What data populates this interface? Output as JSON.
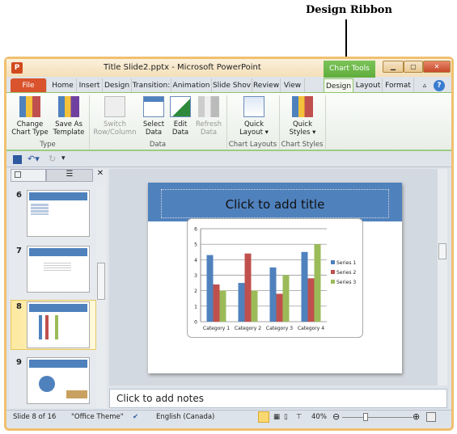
{
  "annotation": {
    "label": "Design Ribbon"
  },
  "window": {
    "title": "Title Slide2.pptx - Microsoft PowerPoint",
    "app_icon": "P",
    "context_tab": "Chart Tools"
  },
  "tabs": [
    "File",
    "Home",
    "Insert",
    "Design",
    "Transition:",
    "Animation",
    "Slide Shov",
    "Review",
    "View",
    "Design",
    "Layout",
    "Format"
  ],
  "ribbon": {
    "buttons": [
      {
        "label1": "Change",
        "label2": "Chart Type",
        "icon": "bar-chart-icon",
        "enabled": true
      },
      {
        "label1": "Save As",
        "label2": "Template",
        "icon": "save-template-icon",
        "enabled": true
      },
      {
        "label1": "Switch",
        "label2": "Row/Column",
        "icon": "switch-row-column-icon",
        "enabled": false
      },
      {
        "label1": "Select",
        "label2": "Data",
        "icon": "select-data-icon",
        "enabled": true
      },
      {
        "label1": "Edit",
        "label2": "Data",
        "icon": "excel-icon",
        "enabled": true
      },
      {
        "label1": "Refresh",
        "label2": "Data",
        "icon": "refresh-icon",
        "enabled": false
      },
      {
        "label1": "Quick",
        "label2": "Layout ▾",
        "icon": "quick-layout-icon",
        "enabled": true
      },
      {
        "label1": "Quick",
        "label2": "Styles ▾",
        "icon": "quick-styles-icon",
        "enabled": true
      }
    ],
    "groups": [
      "Type",
      "Data",
      "Chart Layouts",
      "Chart Styles"
    ]
  },
  "slides": {
    "numbers": [
      "6",
      "7",
      "8",
      "9"
    ],
    "selected": "8"
  },
  "slide": {
    "title_placeholder": "Click to add title"
  },
  "notes": {
    "placeholder": "Click to add notes"
  },
  "status": {
    "slide": "Slide 8 of 16",
    "theme": "\"Office Theme\"",
    "language": "English (Canada)",
    "zoom": "40%",
    "zoom_level": 40
  },
  "colors": {
    "series1": "#4f81bd",
    "series2": "#c0504d",
    "series3": "#9bbb59",
    "accent": "#d9532c",
    "chart_tools": "#6cb84a"
  },
  "chart_data": {
    "type": "bar",
    "categories": [
      "Category 1",
      "Category 2",
      "Category 3",
      "Category 4"
    ],
    "series": [
      {
        "name": "Series 1",
        "values": [
          4.3,
          2.5,
          3.5,
          4.5
        ]
      },
      {
        "name": "Series 2",
        "values": [
          2.4,
          4.4,
          1.8,
          2.8
        ]
      },
      {
        "name": "Series 3",
        "values": [
          2,
          2,
          3,
          5
        ]
      }
    ],
    "ylim": [
      0,
      6
    ],
    "yticks": [
      "0",
      "1",
      "2",
      "3",
      "4",
      "5",
      "6"
    ],
    "grid": true,
    "legend": "right"
  }
}
